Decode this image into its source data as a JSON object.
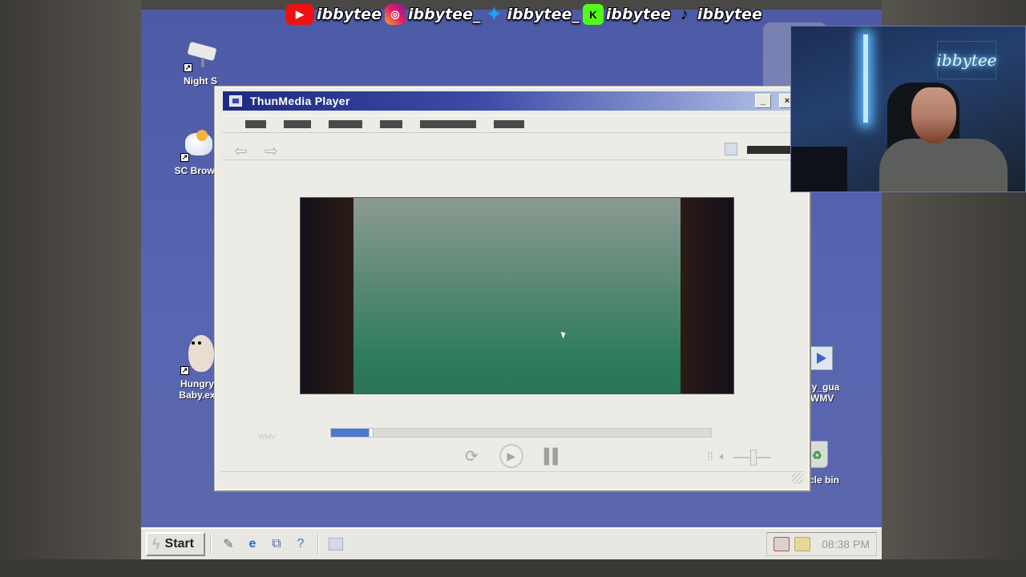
{
  "social": {
    "items": [
      {
        "platform_icon": "youtube-icon",
        "handle": "ibbytee"
      },
      {
        "platform_icon": "instagram-icon",
        "handle": "ibbytee_"
      },
      {
        "platform_icon": "twitter-icon",
        "handle": "ibbytee_"
      },
      {
        "platform_icon": "kick-icon",
        "handle": "ibbytee"
      },
      {
        "platform_icon": "tiktok-icon",
        "handle": "ibbytee"
      }
    ]
  },
  "desktop": {
    "icons": [
      {
        "label": "Night S",
        "icon": "security-camera-icon"
      },
      {
        "label": "SC Brows",
        "icon": "browser-icon"
      },
      {
        "label": "Hungry Baby.ex",
        "icon": "hungry-baby-icon"
      },
      {
        "label": "rity_gua .WMV",
        "icon": "video-file-icon"
      },
      {
        "label": "ecycle bin",
        "icon": "recycle-bin-icon"
      }
    ]
  },
  "player": {
    "title": "ThunMedia Player",
    "minimize_label": "_",
    "close_label": "×",
    "wm_label": "WMV",
    "seek_progress": 0.105,
    "volume_level": 0.5
  },
  "taskbar": {
    "start_label": "Start",
    "clock": "08:38 PM"
  },
  "webcam": {
    "neon_sign": "ibbytee"
  },
  "colors": {
    "title_start": "#1e2a82",
    "title_end": "#b7c9ea",
    "seek_fill": "#4a78d2",
    "desktop_bg": "#5865b0"
  }
}
